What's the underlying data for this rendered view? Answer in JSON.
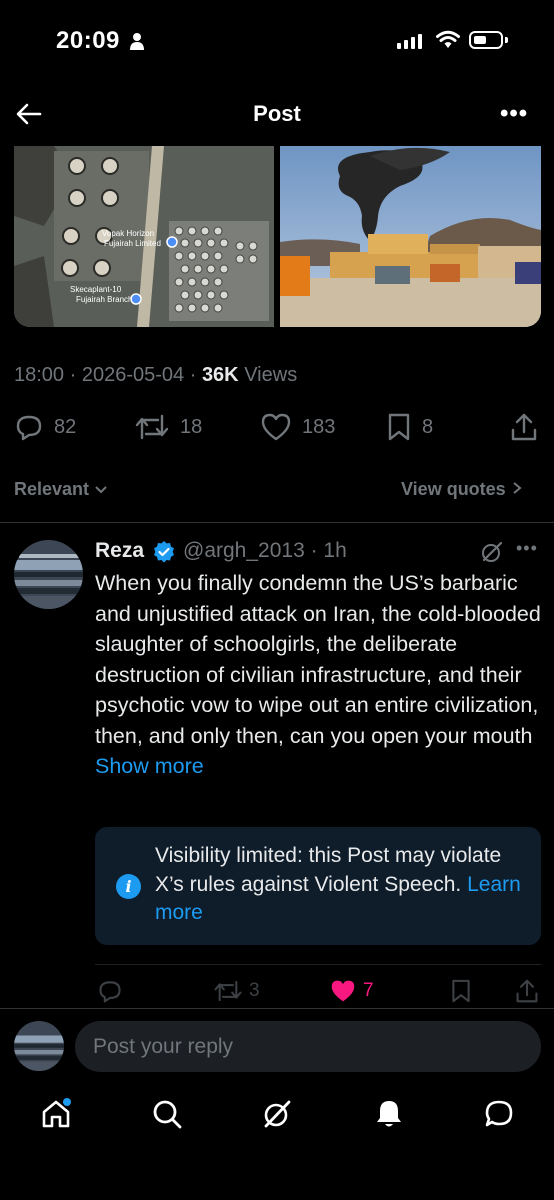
{
  "status_bar": {
    "time": "20:09"
  },
  "header": {
    "title": "Post"
  },
  "post": {
    "time": "18:00",
    "date": "2026-05-04",
    "views_count": "36K",
    "views_label": "Views",
    "replies": "82",
    "reposts": "18",
    "likes": "183",
    "bookmarks": "8",
    "map_labels": [
      "Vopak Horizon",
      "Fujairah Limited",
      "Skecaplant-10",
      "Fujairah Branch"
    ]
  },
  "filters": {
    "relevant": "Relevant",
    "view_quotes": "View quotes"
  },
  "reply": {
    "name": "Reza",
    "handle": "@argh_2013",
    "time": "1h",
    "text": "When you finally condemn the US’s barbaric and unjustified attack on Iran, the cold-blooded slaughter of schoolgirls, the deliberate destruction of civilian infrastructure, and their psychotic vow to wipe out an entire civilization, then, and only then, can you open your mouth",
    "show_more": "Show more",
    "notice_text": "Visibility limited: this Post may violate X’s rules against Violent Speech.",
    "learn_more": "Learn more",
    "reposts": "3",
    "likes": "7"
  },
  "compose": {
    "placeholder": "Post your reply"
  },
  "colors": {
    "accent": "#1d9bf0",
    "like": "#f91880",
    "muted": "#71767b",
    "text": "#e7e9ea"
  },
  "icons": [
    "back-arrow-icon",
    "more-icon",
    "reply-icon",
    "repost-icon",
    "like-icon",
    "bookmark-icon",
    "share-icon",
    "verified-icon",
    "grok-icon",
    "info-icon",
    "home-icon",
    "search-icon",
    "grok-nav-icon",
    "notifications-icon",
    "messages-icon"
  ]
}
